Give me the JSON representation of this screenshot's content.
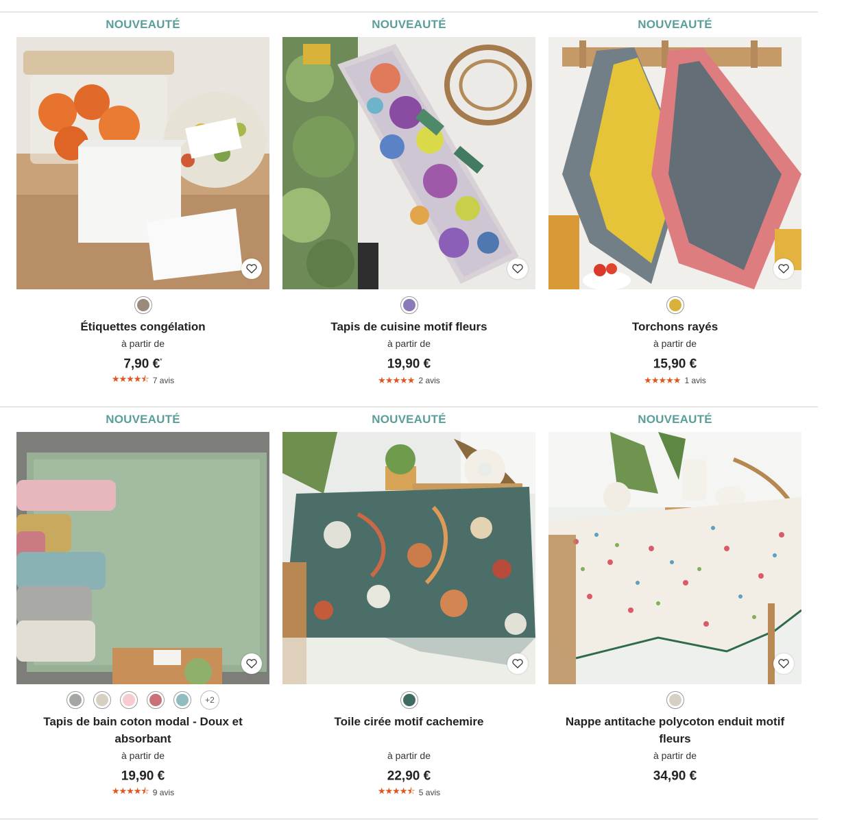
{
  "accent_color": "#5a9e9a",
  "star_color": "#e0561f",
  "products": [
    {
      "badge": "NOUVEAUTÉ",
      "name": "Étiquettes congélation",
      "from": "à partir de",
      "price": "7,90 €",
      "price_sup": "*",
      "stars": "★★★★⯪",
      "reviews": "7 avis",
      "swatches": [
        "#9a8a7a"
      ],
      "more_colors": "",
      "image": "freezer-labels-photo"
    },
    {
      "badge": "NOUVEAUTÉ",
      "name": "Tapis de cuisine motif fleurs",
      "from": "à partir de",
      "price": "19,90 €",
      "price_sup": "",
      "stars": "★★★★★",
      "reviews": "2 avis",
      "swatches": [
        "#8a7ab8"
      ],
      "more_colors": "",
      "image": "floral-kitchen-rug-photo"
    },
    {
      "badge": "NOUVEAUTÉ",
      "name": "Torchons rayés",
      "from": "à partir de",
      "price": "15,90 €",
      "price_sup": "",
      "stars": "★★★★★",
      "reviews": "1 avis",
      "swatches": [
        "#d9b13a"
      ],
      "more_colors": "",
      "image": "striped-tea-towels-photo"
    },
    {
      "badge": "NOUVEAUTÉ",
      "name": "Tapis de bain coton modal - Doux et absorbant",
      "from": "à partir de",
      "price": "19,90 €",
      "price_sup": "",
      "stars": "★★★★⯪",
      "reviews": "9 avis",
      "swatches": [
        "#a3a7a1",
        "#d7d0c2",
        "#f6ccd0",
        "#c9707a",
        "#8fbcbc"
      ],
      "more_colors": "+2",
      "image": "bath-mat-photo"
    },
    {
      "badge": "NOUVEAUTÉ",
      "name": "Toile cirée motif cachemire",
      "from": "à partir de",
      "price": "22,90 €",
      "price_sup": "",
      "stars": "★★★★⯪",
      "reviews": "5 avis",
      "swatches": [
        "#3f6b62"
      ],
      "more_colors": "",
      "image": "paisley-oilcloth-photo"
    },
    {
      "badge": "NOUVEAUTÉ",
      "name": "Nappe antitache polycoton enduit motif fleurs",
      "from": "à partir de",
      "price": "34,90 €",
      "price_sup": "",
      "stars": "",
      "reviews": "",
      "swatches": [
        "#d6cfc4"
      ],
      "more_colors": "",
      "image": "floral-tablecloth-photo"
    }
  ]
}
